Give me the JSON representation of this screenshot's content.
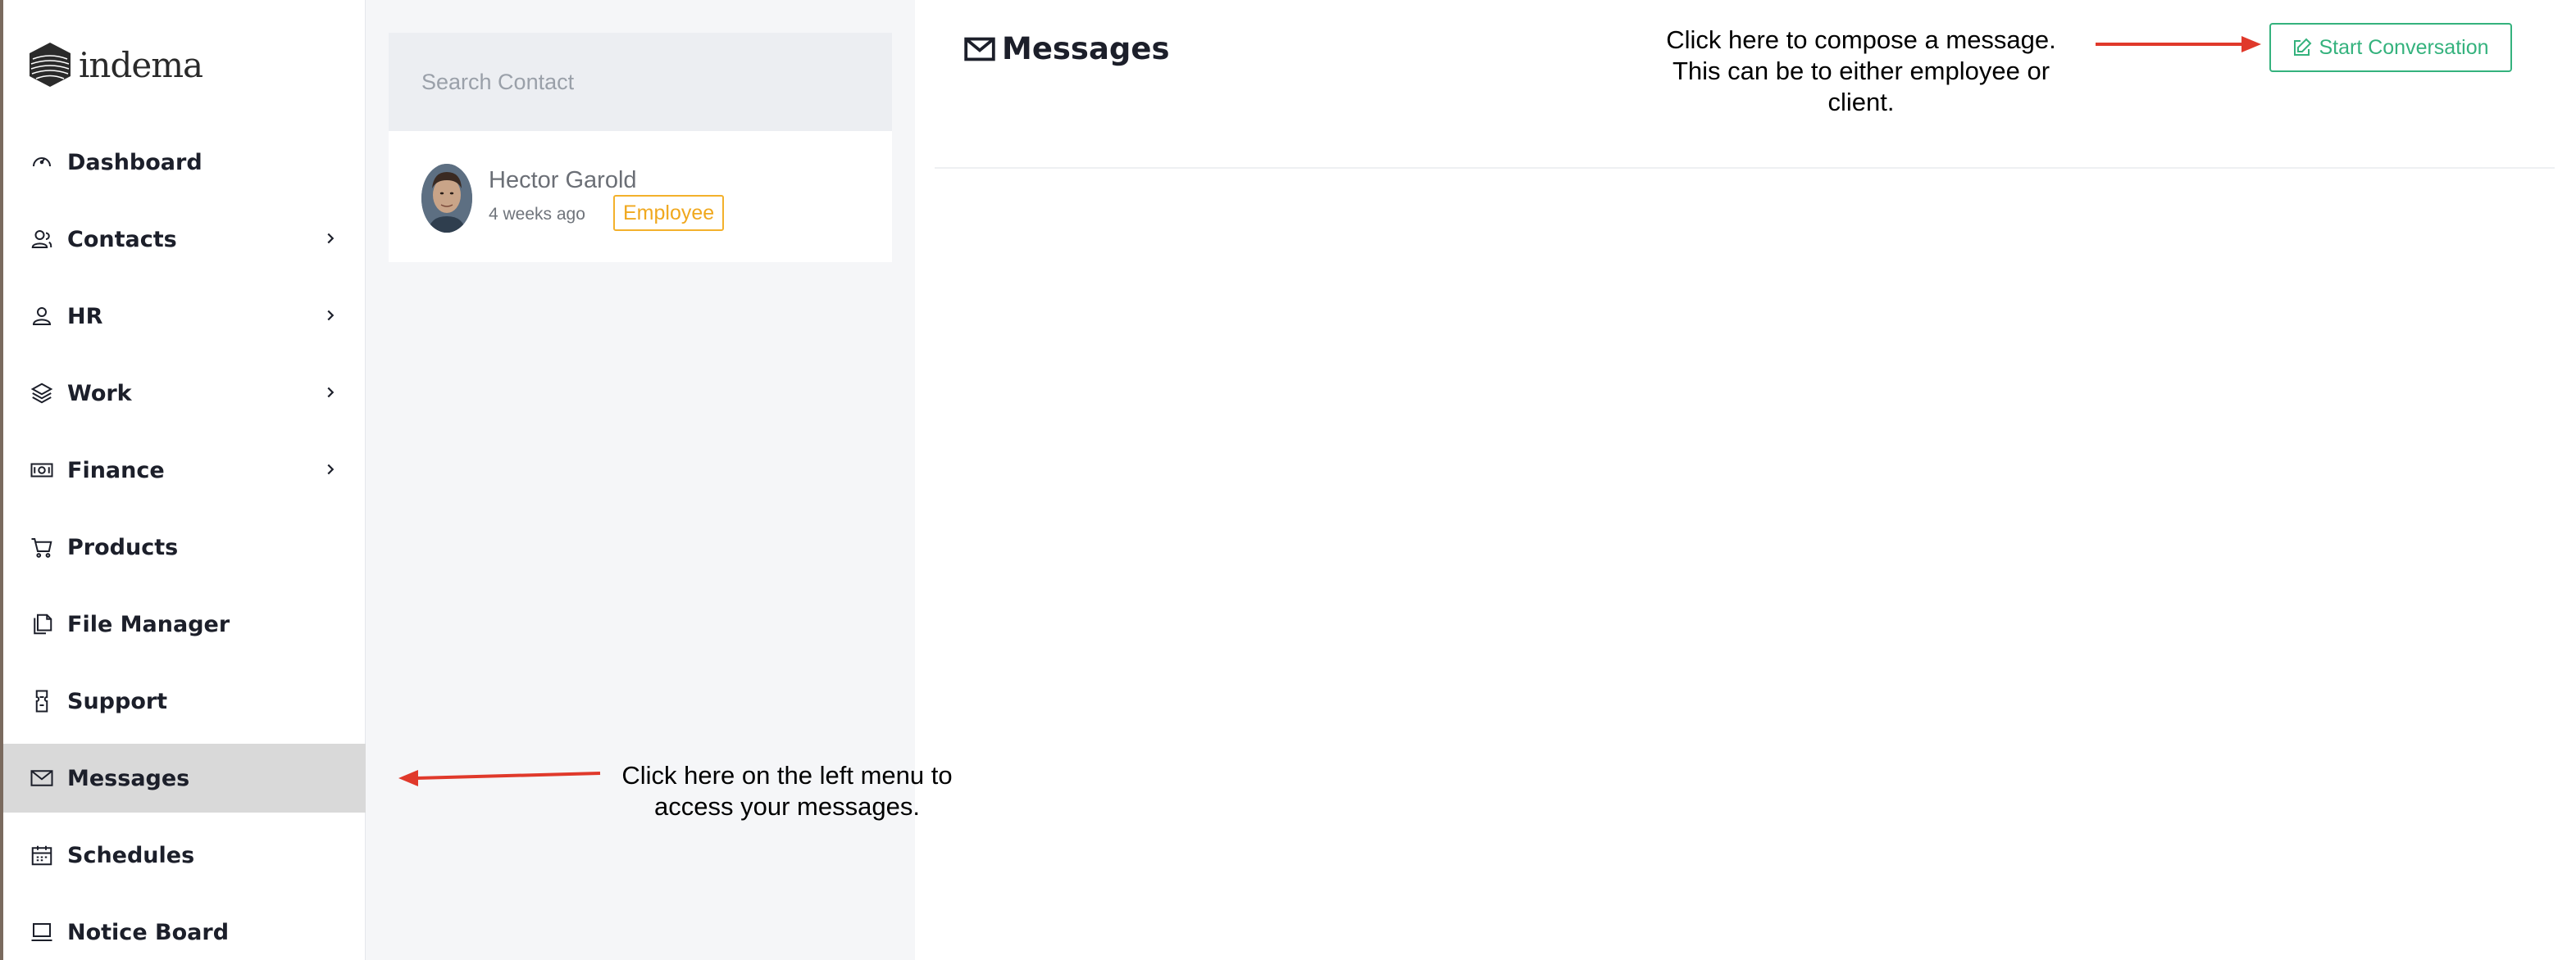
{
  "brand": {
    "name": "indema"
  },
  "sidebar": {
    "items": [
      {
        "label": "Dashboard",
        "icon": "dashboard-icon",
        "has_submenu": false,
        "active": false
      },
      {
        "label": "Contacts",
        "icon": "contacts-icon",
        "has_submenu": true,
        "active": false
      },
      {
        "label": "HR",
        "icon": "user-icon",
        "has_submenu": true,
        "active": false
      },
      {
        "label": "Work",
        "icon": "layers-icon",
        "has_submenu": true,
        "active": false
      },
      {
        "label": "Finance",
        "icon": "money-icon",
        "has_submenu": true,
        "active": false
      },
      {
        "label": "Products",
        "icon": "cart-icon",
        "has_submenu": false,
        "active": false
      },
      {
        "label": "File Manager",
        "icon": "files-icon",
        "has_submenu": false,
        "active": false
      },
      {
        "label": "Support",
        "icon": "ticket-icon",
        "has_submenu": false,
        "active": false
      },
      {
        "label": "Messages",
        "icon": "envelope-icon",
        "has_submenu": false,
        "active": true
      },
      {
        "label": "Schedules",
        "icon": "calendar-icon",
        "has_submenu": false,
        "active": false
      },
      {
        "label": "Notice Board",
        "icon": "laptop-icon",
        "has_submenu": false,
        "active": false
      }
    ]
  },
  "contacts": {
    "search_placeholder": "Search Contact",
    "list": [
      {
        "name": "Hector Garold",
        "time": "4 weeks ago",
        "badge": "Employee"
      }
    ]
  },
  "main": {
    "title": "Messages",
    "start_button_label": "Start Conversation"
  },
  "annotations": {
    "top": [
      "Click here to compose a message.",
      "This can be to either employee or",
      "client."
    ],
    "left": [
      "Click here on the left menu to",
      "access your messages."
    ]
  },
  "colors": {
    "accent_green": "#34b27d",
    "badge_orange": "#f0a81e",
    "active_bg": "#d9d9d9",
    "arrow_red": "#e0392b"
  }
}
